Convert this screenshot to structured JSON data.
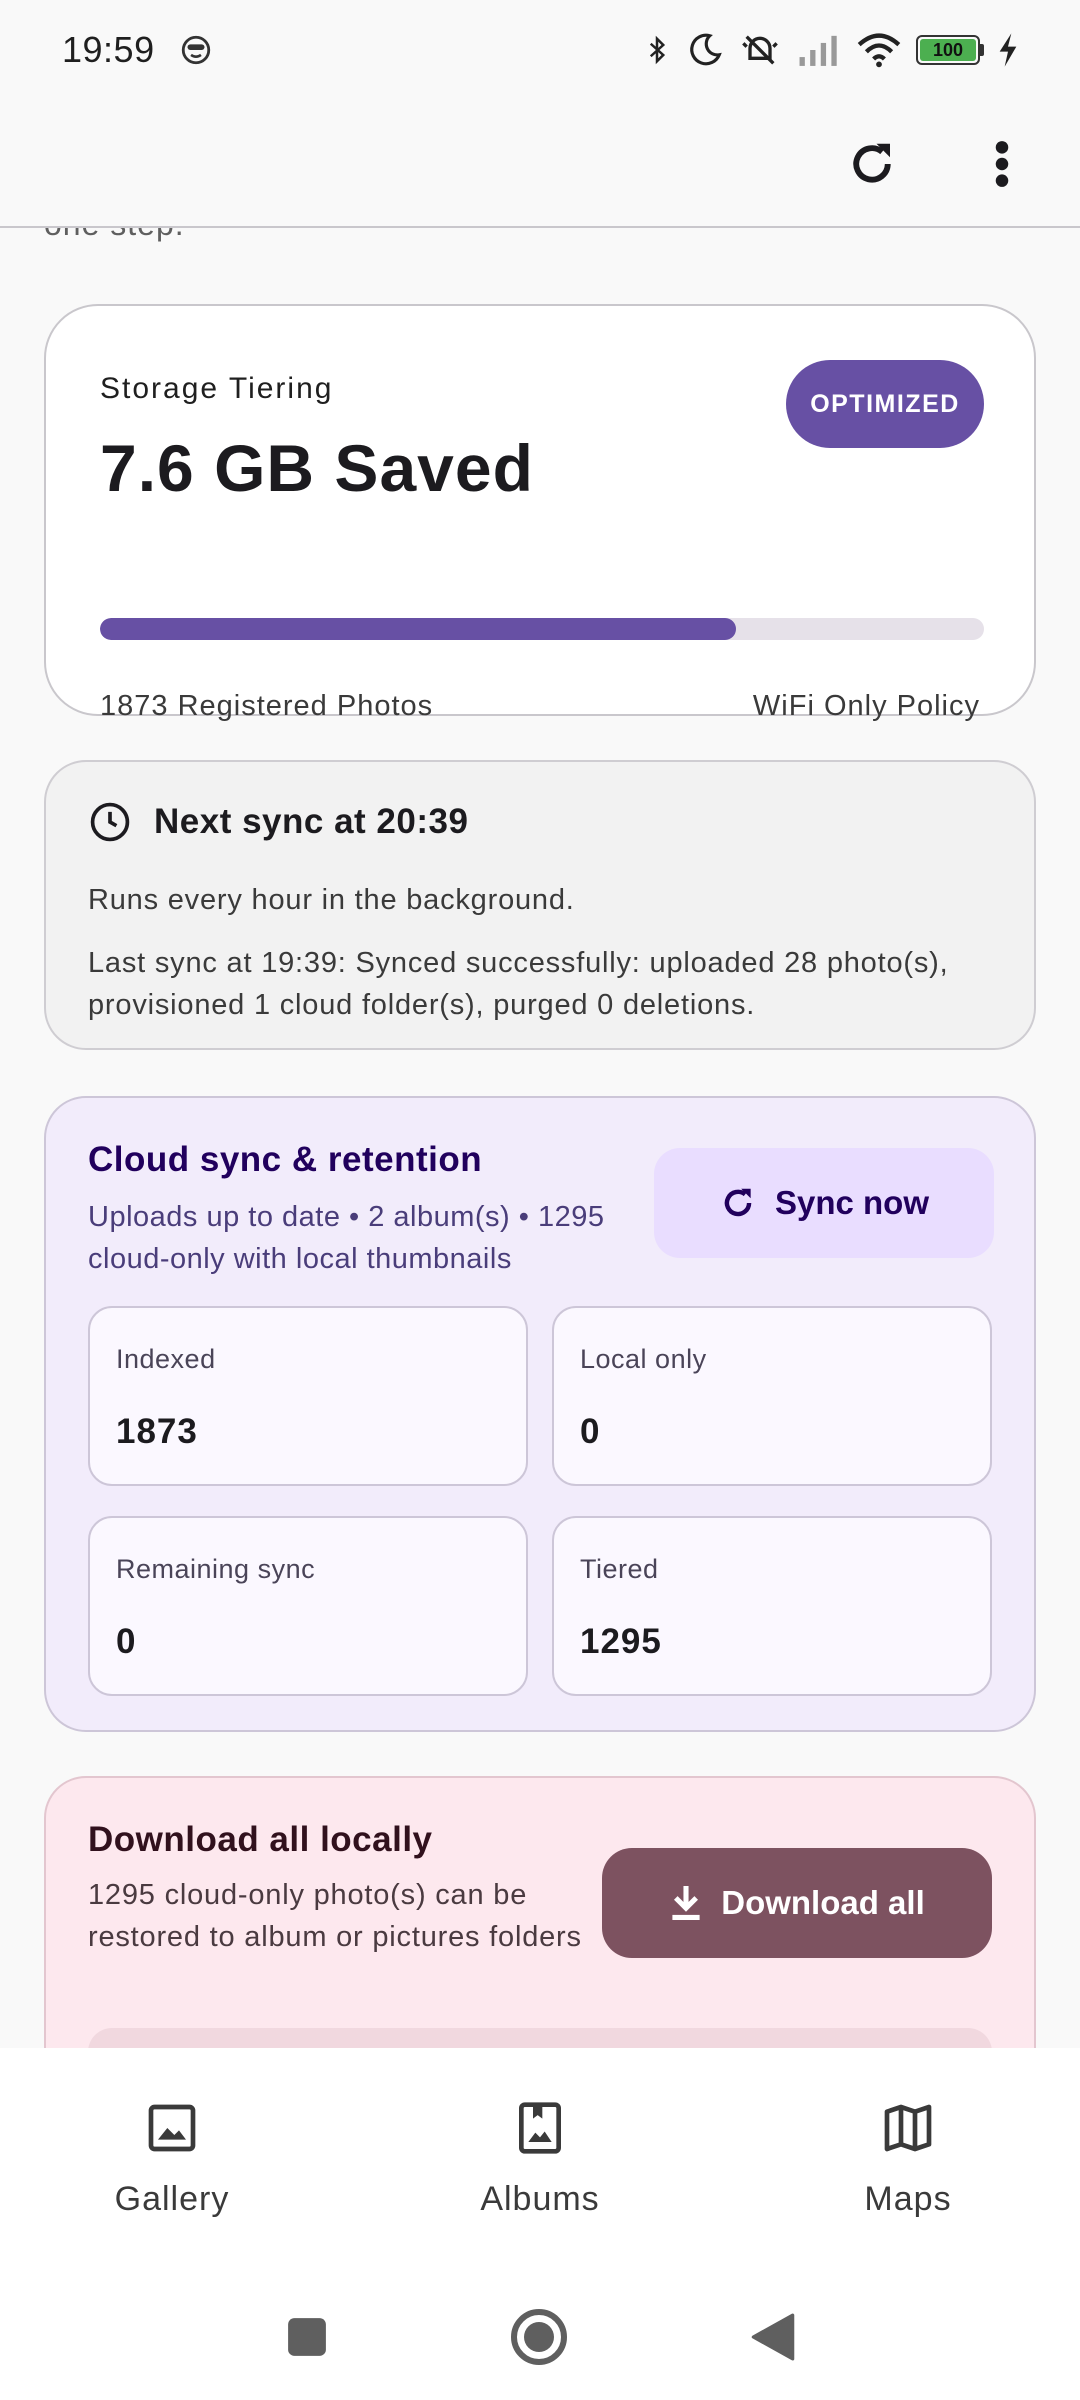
{
  "status_bar": {
    "time": "19:59",
    "battery_level": "100"
  },
  "scroll_peek_text": "one step.",
  "storage": {
    "label": "Storage Tiering",
    "value": "7.6 GB Saved",
    "badge": "OPTIMIZED",
    "progress_fraction": 0.72,
    "photos": "1873 Registered Photos",
    "policy": "WiFi Only Policy"
  },
  "next_sync": {
    "title": "Next sync at 20:39",
    "schedule": "Runs every hour in the background.",
    "last_sync": "Last sync at 19:39: Synced successfully: uploaded 28 photo(s), provisioned 1 cloud folder(s), purged 0 deletions."
  },
  "cloud": {
    "title": "Cloud sync & retention",
    "subtitle": "Uploads up to date • 2 album(s) • 1295 cloud-only with local thumbnails",
    "sync_button": "Sync now",
    "tiles": [
      {
        "label": "Indexed",
        "value": "1873"
      },
      {
        "label": "Local only",
        "value": "0"
      },
      {
        "label": "Remaining sync",
        "value": "0"
      },
      {
        "label": "Tiered",
        "value": "1295"
      }
    ]
  },
  "download": {
    "title": "Download all locally",
    "subtitle": "1295 cloud-only photo(s) can be restored to album or pictures folders",
    "button": "Download all"
  },
  "bottom_nav": [
    {
      "label": "Gallery",
      "icon": "image-icon"
    },
    {
      "label": "Albums",
      "icon": "album-icon"
    },
    {
      "label": "Maps",
      "icon": "map-icon"
    }
  ],
  "colors": {
    "primary": "#6750a4",
    "download_button": "#7d5260",
    "battery": "#4caf50"
  }
}
